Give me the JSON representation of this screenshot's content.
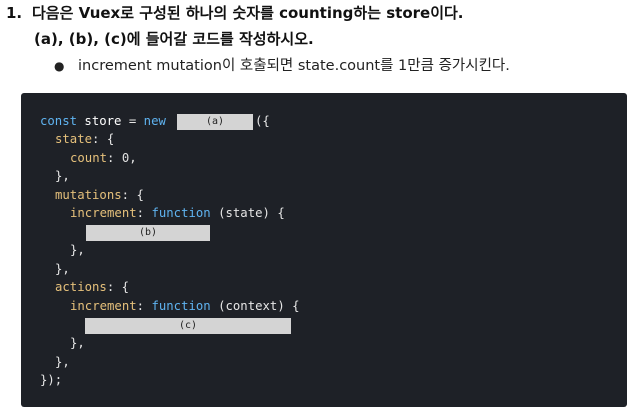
{
  "question": {
    "number": "1.",
    "title": "다음은 Vuex로 구성된 하나의 숫자를 counting하는 store이다.",
    "instruction": "(a), (b), (c)에 들어갈 코드를 작성하시오.",
    "bullet": "increment mutation이 호출되면 state.count를 1만큼 증가시킨다."
  },
  "code": {
    "l1_const": "const",
    "l1_store": " store ",
    "l1_eq": "=",
    "l1_new": " new ",
    "l1_tail": "({",
    "l2_state": "state",
    "l2_tail": ": {",
    "l3_count": "count",
    "l3_colon": ": ",
    "l3_zero": "0",
    "l3_comma": ",",
    "l4": "},",
    "l5_mutations": "mutations",
    "l5_tail": ": {",
    "l6_increment": "increment",
    "l6_colon": ": ",
    "l6_function": "function",
    "l6_args": " (state) {",
    "l8": "},",
    "l9": "},",
    "l10_actions": "actions",
    "l10_tail": ": {",
    "l11_increment": "increment",
    "l11_colon": ": ",
    "l11_function": "function",
    "l11_args": " (context) {",
    "l13": "},",
    "l14": "},",
    "l15": "});",
    "blank_a": "(a)",
    "blank_b": "(b)",
    "blank_c": "(c)"
  }
}
